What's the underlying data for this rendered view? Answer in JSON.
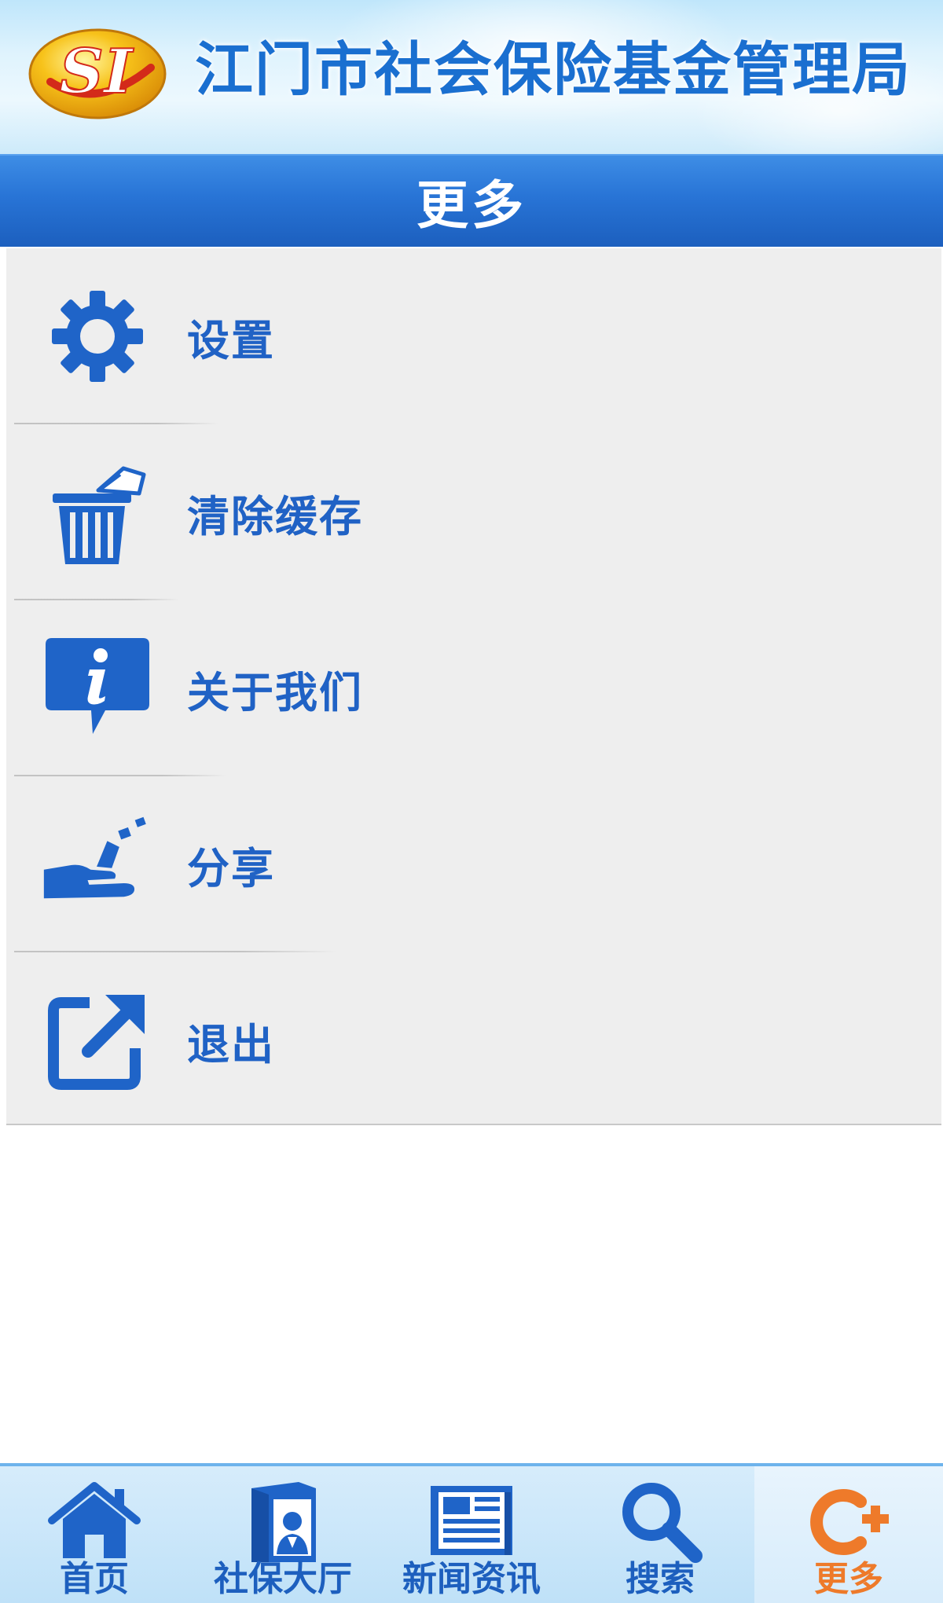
{
  "header": {
    "logo_text": "SI",
    "org_name": "江门市社会保险基金管理局"
  },
  "titlebar": {
    "title": "更多"
  },
  "menu": {
    "items": [
      {
        "label": "设置",
        "icon": "gear-icon"
      },
      {
        "label": "清除缓存",
        "icon": "trash-icon"
      },
      {
        "label": "关于我们",
        "icon": "info-icon"
      },
      {
        "label": "分享",
        "icon": "share-icon"
      },
      {
        "label": "退出",
        "icon": "exit-icon"
      }
    ]
  },
  "tabbar": {
    "tabs": [
      {
        "label": "首页",
        "icon": "home-icon"
      },
      {
        "label": "社保大厅",
        "icon": "book-icon"
      },
      {
        "label": "新闻资讯",
        "icon": "newspaper-icon"
      },
      {
        "label": "搜索",
        "icon": "search-icon"
      },
      {
        "label": "更多",
        "icon": "more-icon",
        "active": true
      }
    ]
  },
  "colors": {
    "primary_blue": "#2874d6",
    "icon_blue": "#1f64c8",
    "active_orange": "#ee7a2a",
    "menu_bg": "#eeeeee"
  }
}
